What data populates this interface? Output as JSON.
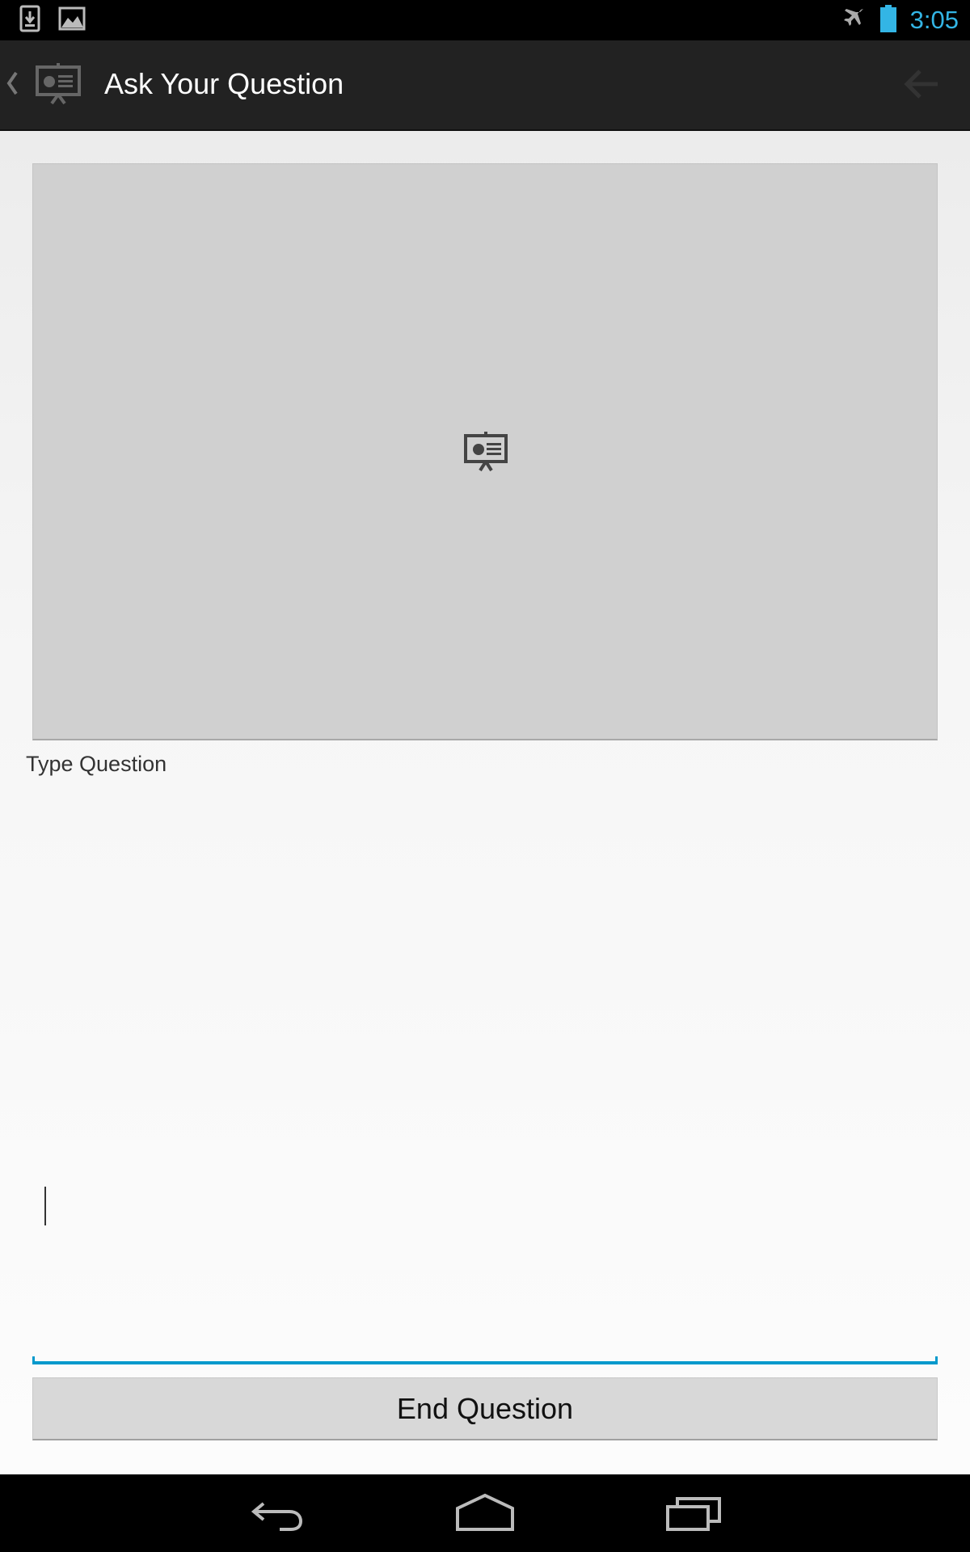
{
  "status_bar": {
    "time": "3:05",
    "icons": [
      "download-notification-icon",
      "image-notification-icon",
      "airplane-mode-icon",
      "battery-icon"
    ],
    "accent_color": "#33b5e5"
  },
  "action_bar": {
    "title": "Ask Your Question",
    "icons": [
      "up-caret-icon",
      "presentation-app-icon",
      "back-arrow-icon"
    ]
  },
  "main": {
    "preview_icon": "presentation-icon",
    "question_label": "Type Question",
    "question_value": "",
    "end_button_label": "End Question",
    "focus_color": "#0099cc"
  },
  "nav_bar": {
    "buttons": [
      "back-icon",
      "home-icon",
      "recent-apps-icon"
    ]
  }
}
